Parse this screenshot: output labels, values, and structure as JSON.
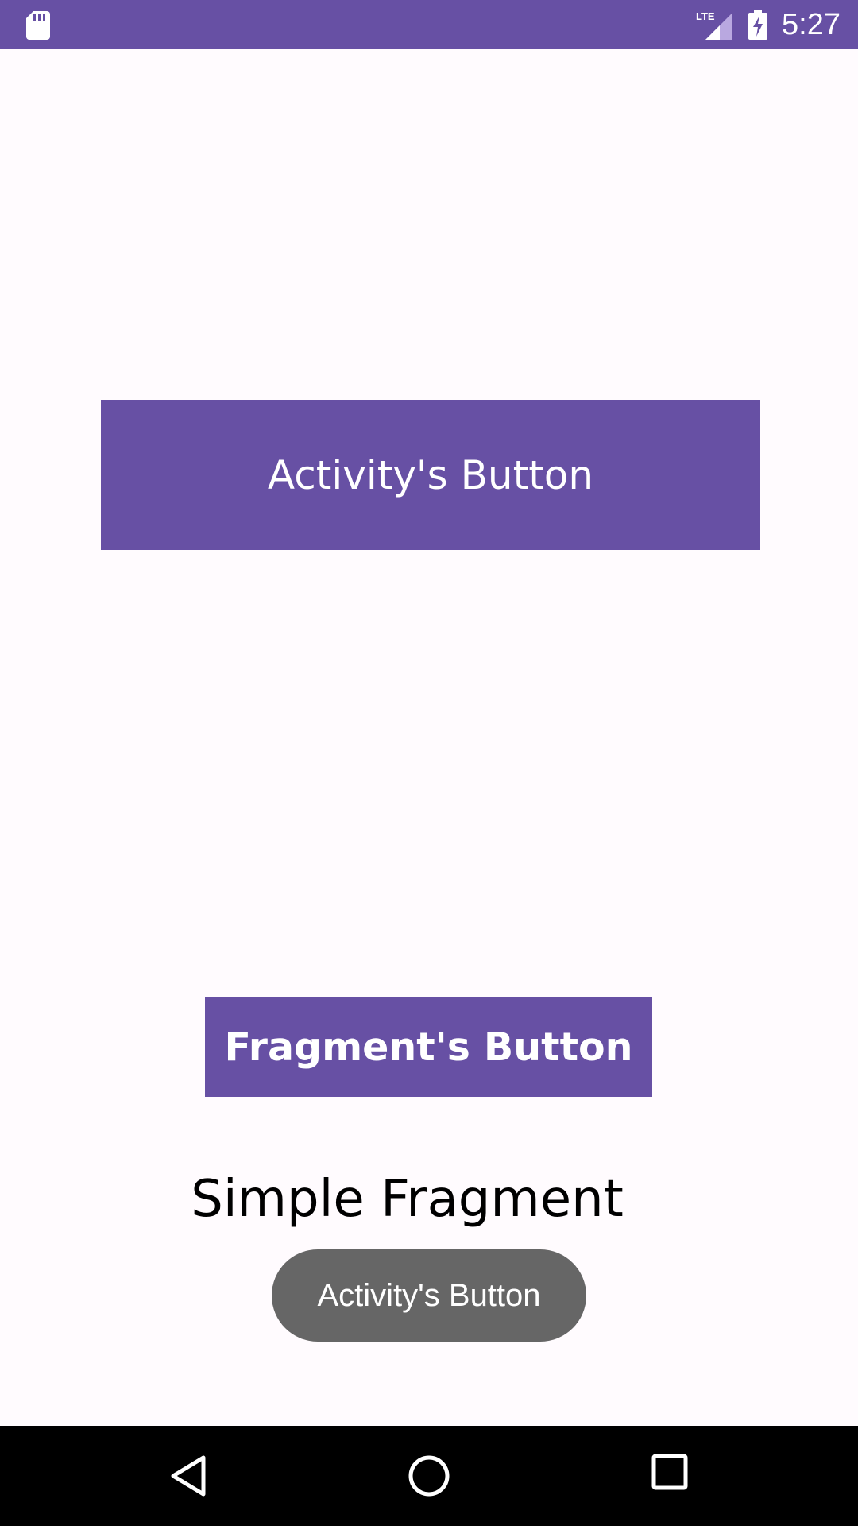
{
  "status_bar": {
    "time": "5:27",
    "sd_icon": "sd-card-icon",
    "network_label": "LTE",
    "battery_icon": "battery-charging-icon",
    "background_color": "#6750a4"
  },
  "main": {
    "activity_button_label": "Activity's Button",
    "fragment_button_label": "Fragment's Button",
    "fragment_title": "Simple Fragment",
    "button_color": "#6750a4"
  },
  "toast": {
    "message": "Activity's Button"
  },
  "nav_bar": {
    "back_icon": "back-icon",
    "home_icon": "home-icon",
    "recents_icon": "recents-icon"
  }
}
